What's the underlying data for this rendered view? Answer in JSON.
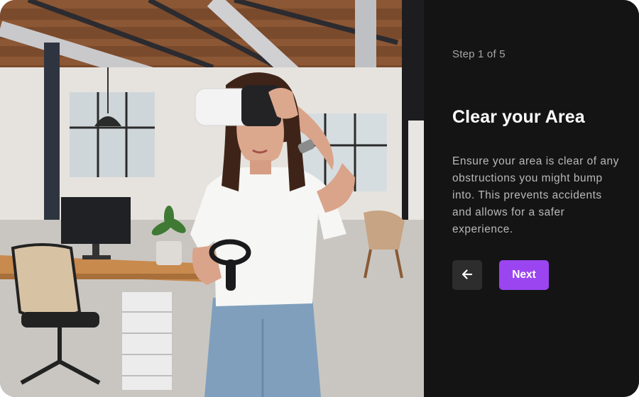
{
  "step": {
    "label": "Step 1 of 5"
  },
  "content": {
    "title": "Clear your Area",
    "description": "Ensure your area is clear of any obstructions you might bump into. This prevents accidents and allows for a safer  experience."
  },
  "actions": {
    "back_icon": "arrow-left-icon",
    "next_label": "Next"
  },
  "photo": {
    "subject": "woman-wearing-vr-headset-in-office"
  },
  "colors": {
    "panel_bg": "#141414",
    "accent": "#9a45f0",
    "back_button_bg": "#2d2d2d",
    "title": "#ffffff",
    "body_text": "#b9b9b9",
    "step_text": "#a6a6a6"
  }
}
